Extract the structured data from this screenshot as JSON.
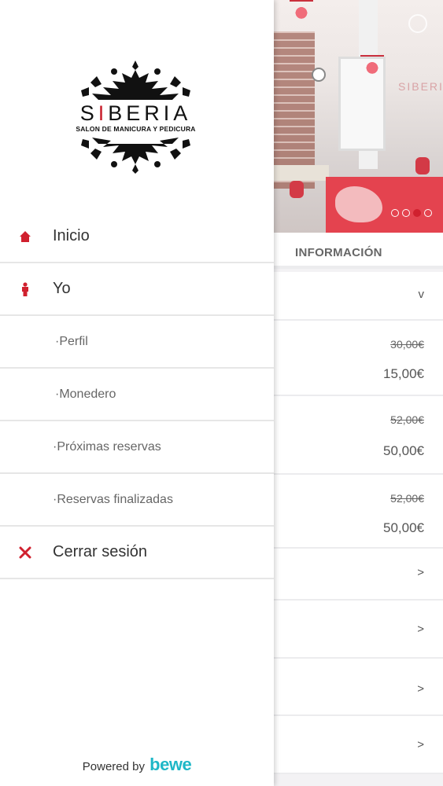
{
  "drawer": {
    "logo": {
      "brand_prefix": "S",
      "brand_i": "I",
      "brand_suffix": "BERIA",
      "tagline": "SALON DE MANICURA Y PEDICURA"
    },
    "menu": [
      {
        "label": "Inicio",
        "icon": "home-icon"
      },
      {
        "label": "Yo",
        "icon": "person-icon"
      },
      {
        "label": "·Perfil"
      },
      {
        "label": "·Monedero"
      },
      {
        "label": "·Próximas reservas"
      },
      {
        "label": "·Reservas finalizadas"
      },
      {
        "label": "Cerrar sesión",
        "icon": "close-icon"
      }
    ],
    "powered_by": "Powered by",
    "powered_brand": "bewe"
  },
  "background": {
    "section_title": "INFORMACIÓN",
    "collapse_icon": "v",
    "prices": [
      {
        "old": "30,00€",
        "new": "15,00€"
      },
      {
        "old": "52,00€",
        "new": "50,00€"
      },
      {
        "old": "52,00€",
        "new": "50,00€"
      }
    ],
    "chevron": ">",
    "carousel": {
      "slides": 4,
      "active": 3
    }
  },
  "colors": {
    "accent": "#d0202e",
    "bewe": "#1eb7c7"
  }
}
